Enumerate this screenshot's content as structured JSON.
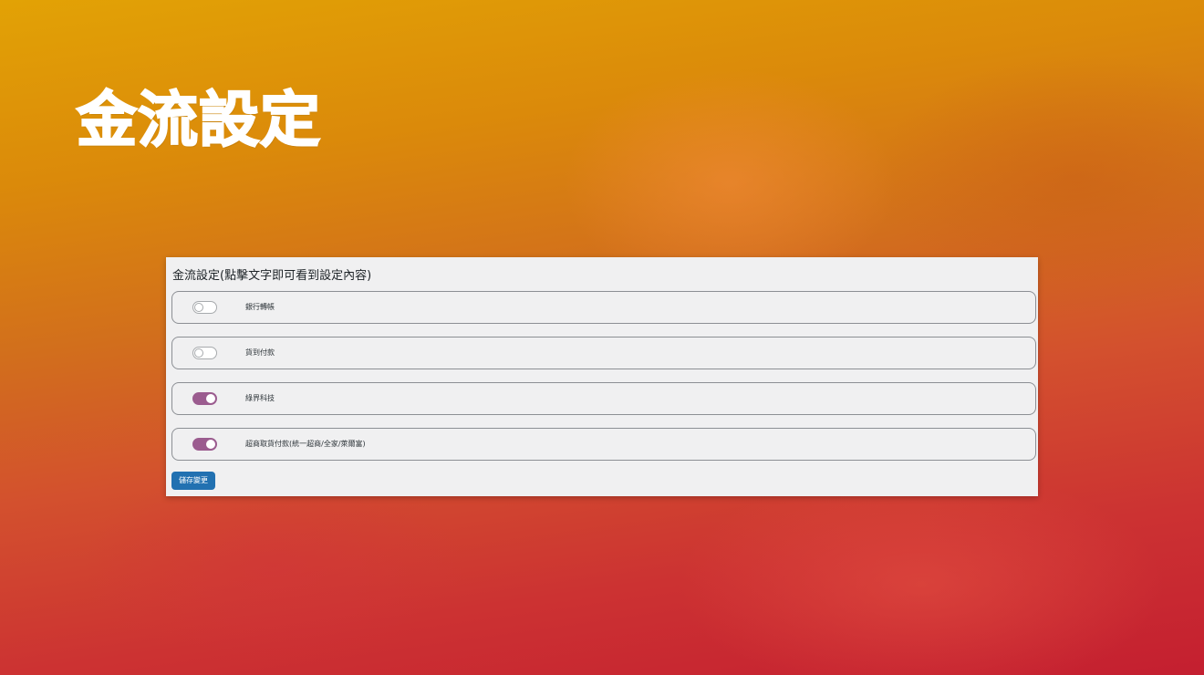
{
  "hero": {
    "title": "金流設定"
  },
  "panel": {
    "title": "金流設定(點擊文字即可看到設定內容)",
    "methods": [
      {
        "label": "銀行轉帳",
        "enabled": false
      },
      {
        "label": "貨到付款",
        "enabled": false
      },
      {
        "label": "綠界科技",
        "enabled": true
      },
      {
        "label": "超商取貨付款(統一超商/全家/萊爾富)",
        "enabled": true
      }
    ],
    "save_label": "儲存變更"
  },
  "colors": {
    "toggle_on": "#9b5c8f",
    "toggle_off": "#ffffff",
    "primary_button": "#2271b1",
    "panel_background": "#f0f0f1"
  }
}
